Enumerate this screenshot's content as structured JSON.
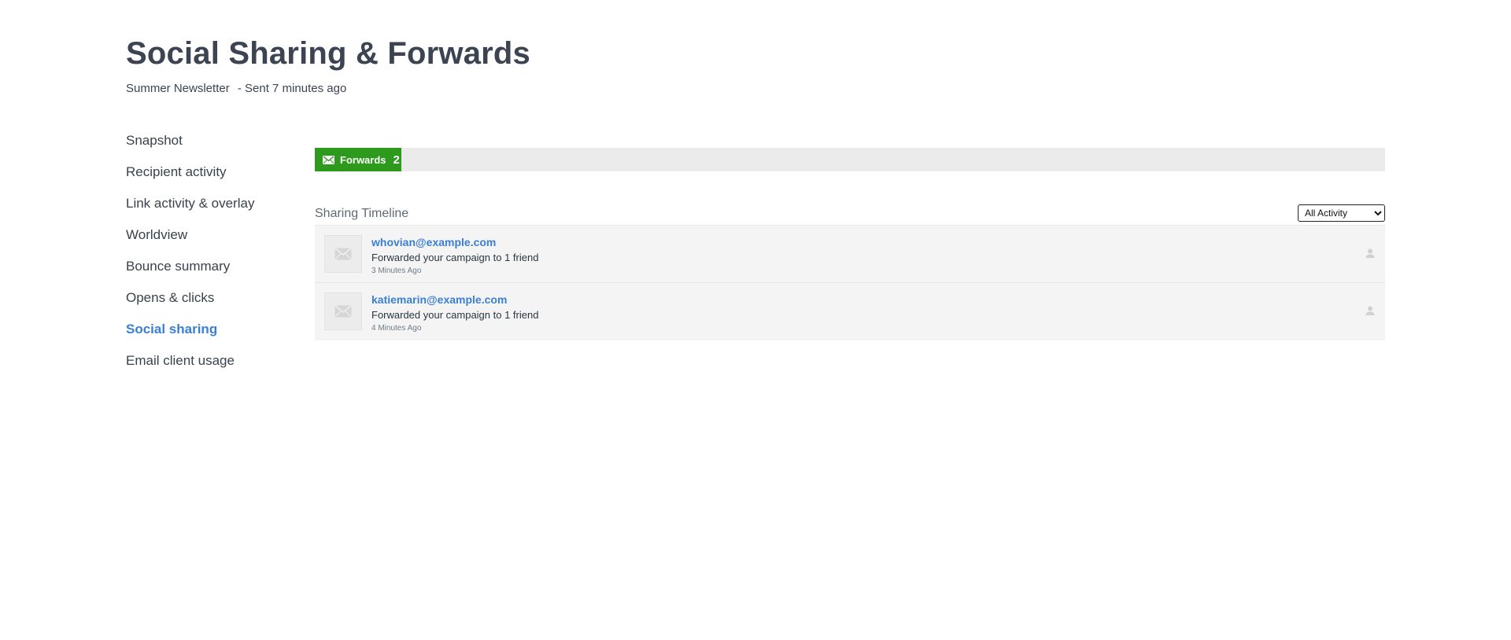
{
  "header": {
    "title": "Social Sharing & Forwards",
    "campaign": "Summer Newsletter",
    "sent": "- Sent 7 minutes ago"
  },
  "sidebar": {
    "items": [
      {
        "label": "Snapshot"
      },
      {
        "label": "Recipient activity"
      },
      {
        "label": "Link activity & overlay"
      },
      {
        "label": "Worldview"
      },
      {
        "label": "Bounce summary"
      },
      {
        "label": "Opens & clicks"
      },
      {
        "label": "Social sharing",
        "active": true
      },
      {
        "label": "Email client usage"
      }
    ]
  },
  "stats": {
    "forwards_label": "Forwards",
    "forwards_count": "2",
    "icon": "envelope-icon",
    "color": "#2d9a1e"
  },
  "timeline": {
    "title": "Sharing Timeline",
    "filter": {
      "selected": "All Activity",
      "options": [
        "All Activity"
      ]
    },
    "rows": [
      {
        "email": "whovian@example.com",
        "description": "Forwarded your campaign to 1 friend",
        "time": "3 Minutes Ago"
      },
      {
        "email": "katiemarin@example.com",
        "description": "Forwarded your campaign to 1 friend",
        "time": "4 Minutes Ago"
      }
    ]
  },
  "colors": {
    "accent_link": "#3a7fd6",
    "forwards_green": "#2d9a1e",
    "title_text": "#3c4452"
  }
}
